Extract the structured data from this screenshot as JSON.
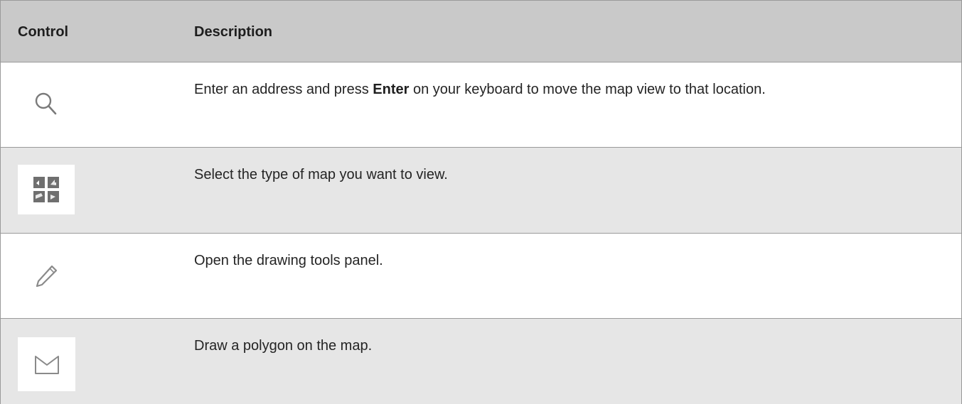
{
  "table": {
    "headers": {
      "control": "Control",
      "description": "Description"
    },
    "rows": [
      {
        "icon": "search-icon",
        "desc_before": "Enter an address and press ",
        "desc_bold": "Enter",
        "desc_after": " on your keyboard to move the map view to that location."
      },
      {
        "icon": "map-type-icon",
        "desc": "Select the type of map you want to view."
      },
      {
        "icon": "pencil-icon",
        "desc": "Open the drawing tools panel."
      },
      {
        "icon": "polygon-icon",
        "desc": "Draw a polygon on the map."
      }
    ]
  },
  "colors": {
    "header_bg": "#c9c9c9",
    "alt_row_bg": "#e6e6e6",
    "border": "#9a9a9a",
    "icon_gray": "#777777"
  }
}
